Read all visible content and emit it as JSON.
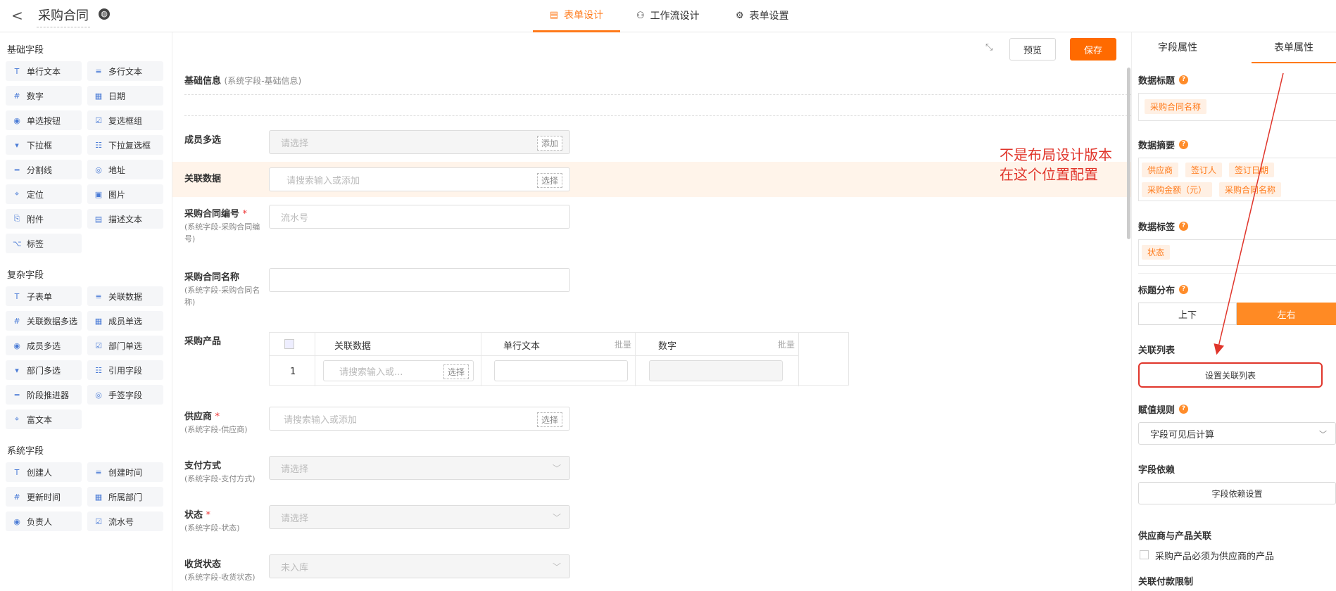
{
  "header": {
    "back": "<",
    "title": "采购合同",
    "tabs": [
      {
        "label": "表单设计",
        "icon": "form-icon",
        "active": true
      },
      {
        "label": "工作流设计",
        "icon": "workflow-icon",
        "active": false
      },
      {
        "label": "表单设置",
        "icon": "gear-icon",
        "active": false
      }
    ]
  },
  "sidebar": {
    "basic_title": "基础字段",
    "basic": [
      "单行文本",
      "多行文本",
      "数字",
      "日期",
      "单选按钮",
      "复选框组",
      "下拉框",
      "下拉复选框",
      "分割线",
      "地址",
      "定位",
      "图片",
      "附件",
      "描述文本",
      "标签"
    ],
    "complex_title": "复杂字段",
    "complex": [
      "子表单",
      "关联数据",
      "关联数据多选",
      "成员单选",
      "成员多选",
      "部门单选",
      "部门多选",
      "引用字段",
      "阶段推进器",
      "手签字段",
      "富文本"
    ],
    "system_title": "系统字段",
    "system": [
      "创建人",
      "创建时间",
      "更新时间",
      "所属部门",
      "负责人",
      "流水号"
    ]
  },
  "toolbar": {
    "preview": "预览",
    "save": "保存"
  },
  "canvas": {
    "section_title": "基础信息",
    "section_sub": "(系统字段-基础信息)",
    "members": {
      "label": "成员多选",
      "placeholder": "请选择",
      "action": "添加"
    },
    "related": {
      "label": "关联数据",
      "placeholder": "请搜索输入或添加",
      "action": "选择"
    },
    "contract_no": {
      "label": "采购合同编号",
      "sub": "(系统字段-采购合同编号)",
      "placeholder": "流水号"
    },
    "contract_name": {
      "label": "采购合同名称",
      "sub": "(系统字段-采购合同名称)"
    },
    "product": {
      "label": "采购产品",
      "col1": "关联数据",
      "col2": "单行文本",
      "col3": "数字",
      "batch": "批量",
      "row_index": "1",
      "row_placeholder": "请搜索输入或...",
      "row_action": "选择"
    },
    "supplier": {
      "label": "供应商",
      "sub": "(系统字段-供应商)",
      "placeholder": "请搜索输入或添加",
      "action": "选择"
    },
    "payment": {
      "label": "支付方式",
      "sub": "(系统字段-支付方式)",
      "placeholder": "请选择"
    },
    "status": {
      "label": "状态",
      "sub": "(系统字段-状态)",
      "placeholder": "请选择"
    },
    "receipt": {
      "label": "收货状态",
      "sub": "(系统字段-收货状态)",
      "placeholder": "未入库"
    },
    "required_mark": "*"
  },
  "annotation": {
    "line1": "不是布局设计版本",
    "line2": "在这个位置配置",
    "color": "#e0352b"
  },
  "panel": {
    "tabs": [
      "字段属性",
      "表单属性"
    ],
    "data_title": {
      "label": "数据标题",
      "chips": [
        "采购合同名称"
      ]
    },
    "data_summary": {
      "label": "数据摘要",
      "chips": [
        "供应商",
        "签订人",
        "签订日期",
        "采购金额（元）",
        "采购合同名称"
      ]
    },
    "data_tags": {
      "label": "数据标签",
      "chips": [
        "状态"
      ]
    },
    "title_layout": {
      "label": "标题分布",
      "options": [
        "上下",
        "左右"
      ],
      "selected": "左右"
    },
    "related_list": {
      "label": "关联列表",
      "button": "设置关联列表"
    },
    "value_rule": {
      "label": "赋值规则",
      "value": "字段可见后计算"
    },
    "dependency": {
      "label": "字段依赖",
      "button": "字段依赖设置"
    },
    "supplier_product": {
      "label": "供应商与产品关联",
      "checkbox": "采购产品必须为供应商的产品"
    },
    "payment_limit": {
      "label": "关联付款限制"
    }
  },
  "colors": {
    "accent": "#ff7a1a",
    "save": "#ff6a00",
    "highlight_row": "#fff4ea",
    "annotation": "#e0352b"
  }
}
